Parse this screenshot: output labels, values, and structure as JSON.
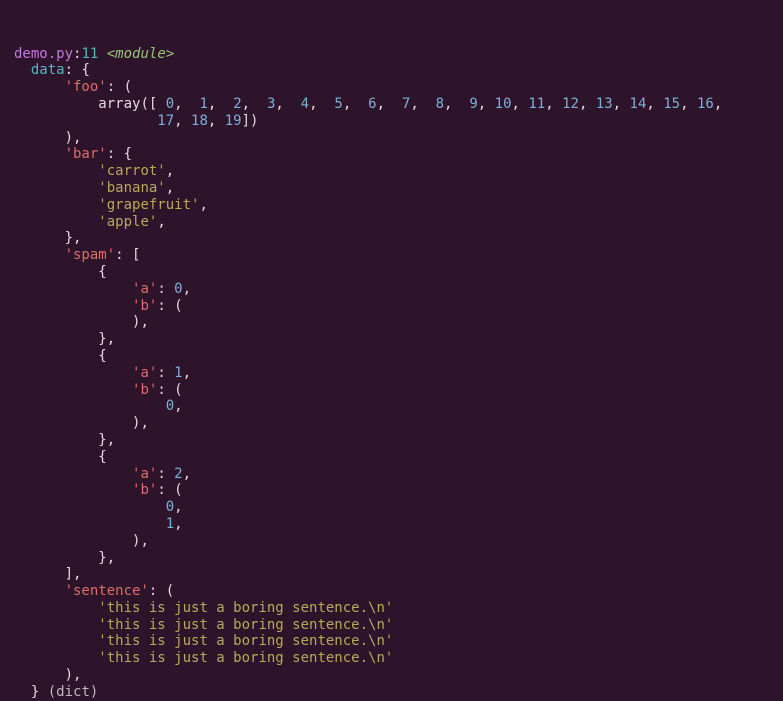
{
  "header": {
    "filename": "demo.py",
    "sep": ":",
    "lineno": "11",
    "module": "<module>"
  },
  "var": {
    "name": "data",
    "colon": ": ",
    "open": "{"
  },
  "foo": {
    "key": "'foo'",
    "colon": ": (",
    "array_open": "array([ ",
    "nums": [
      "0",
      "1",
      "2",
      "3",
      "4",
      "5",
      "6",
      "7",
      "8",
      "9",
      "10",
      "11",
      "12",
      "13",
      "14",
      "15",
      "16",
      "17",
      "18",
      "19"
    ],
    "array_close": "])",
    "close": "),"
  },
  "bar": {
    "key": "'bar'",
    "colon": ": {",
    "items": [
      "'carrot'",
      "'banana'",
      "'grapefruit'",
      "'apple'"
    ],
    "close": "},"
  },
  "spam": {
    "key": "'spam'",
    "colon": ": [",
    "entries": [
      {
        "open": "{",
        "a_key": "'a'",
        "a_val": "0",
        "b_key": "'b'",
        "b_open": "(",
        "b_vals": [],
        "b_close": "),",
        "close": "},"
      },
      {
        "open": "{",
        "a_key": "'a'",
        "a_val": "1",
        "b_key": "'b'",
        "b_open": "(",
        "b_vals": [
          "0"
        ],
        "b_close": "),",
        "close": "},"
      },
      {
        "open": "{",
        "a_key": "'a'",
        "a_val": "2",
        "b_key": "'b'",
        "b_open": "(",
        "b_vals": [
          "0",
          "1"
        ],
        "b_close": "),",
        "close": "},"
      }
    ],
    "close": "],"
  },
  "sentence": {
    "key": "'sentence'",
    "colon": ": (",
    "lines": [
      "'this is just a boring sentence.\\n'",
      "'this is just a boring sentence.\\n'",
      "'this is just a boring sentence.\\n'",
      "'this is just a boring sentence.\\n'"
    ],
    "close": "),"
  },
  "footer": {
    "close": "}",
    "type": " (dict)"
  },
  "sep": ", ",
  "comma": ","
}
